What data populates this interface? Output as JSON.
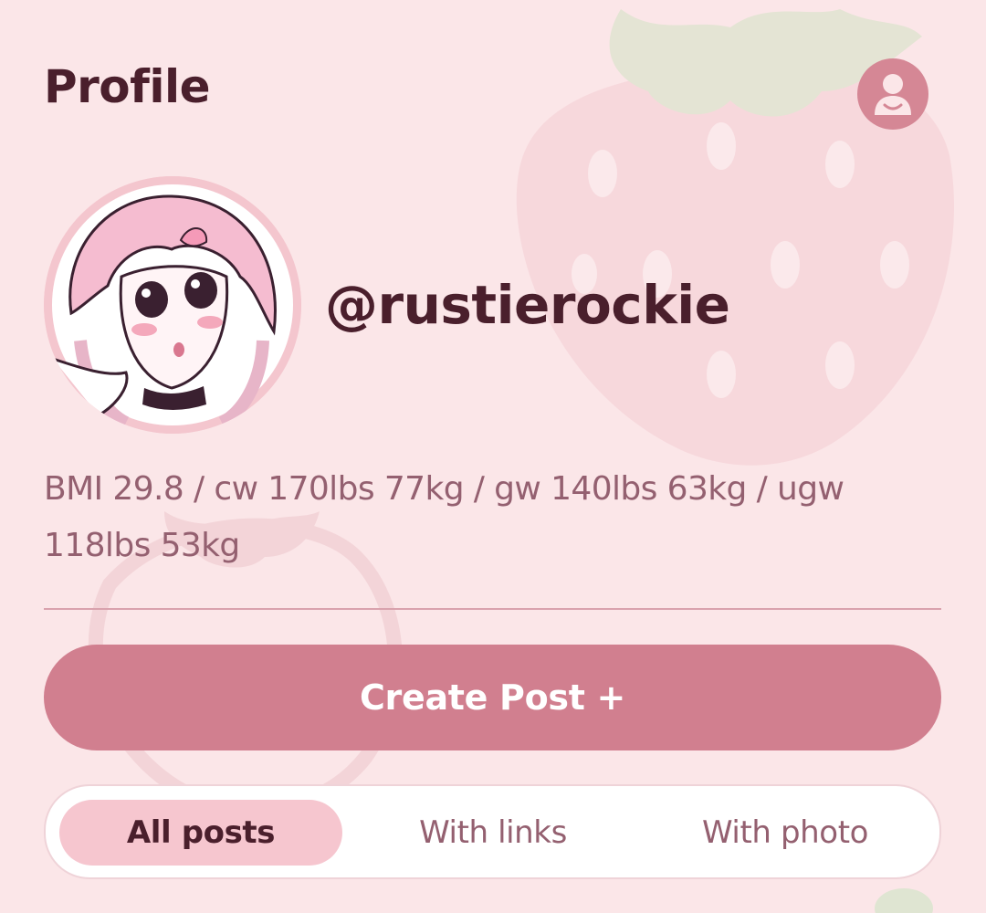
{
  "header": {
    "title": "Profile",
    "account_icon": "account-icon"
  },
  "profile": {
    "username": "@rustierockie",
    "avatar_icon": "avatar-image",
    "bio": "BMI 29.8 / cw 170lbs 77kg / gw 140lbs 63kg / ugw 118lbs 53kg"
  },
  "actions": {
    "create_post_label": "Create Post +"
  },
  "tabs": [
    {
      "label": "All posts",
      "active": true
    },
    {
      "label": "With links",
      "active": false
    },
    {
      "label": "With photo",
      "active": false
    }
  ],
  "colors": {
    "background": "#fbe6e8",
    "accent": "#d17f8f",
    "text_dark": "#4a1f2c",
    "text_muted": "#946070",
    "tab_active": "#f6c6cf"
  }
}
